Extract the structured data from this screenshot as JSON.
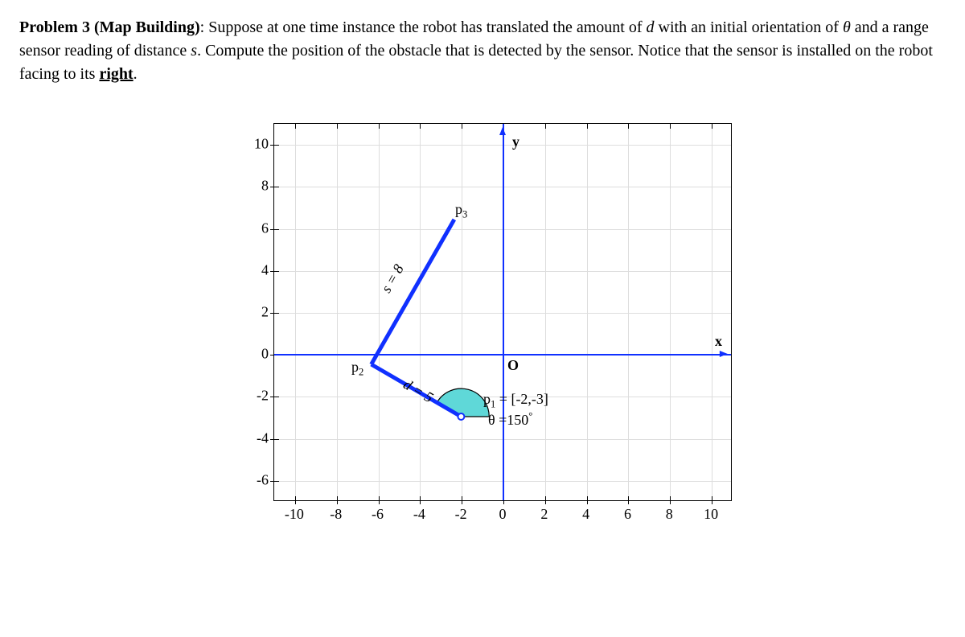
{
  "problem": {
    "label_bold": "Problem 3 (Map Building)",
    "sentence_part1": ": Suppose at one time instance the robot has translated the amount of ",
    "var_d": "d",
    "sentence_part2": " with an initial orientation of ",
    "var_theta": "θ",
    "sentence_part3": " and a range sensor reading of distance ",
    "var_s": "s",
    "sentence_part4": ". Compute the position of the obstacle that is detected by the sensor. Notice that the sensor is installed on the robot facing to its ",
    "right_word": "right",
    "period": "."
  },
  "chart_data": {
    "type": "line",
    "xlim": [
      -11,
      11
    ],
    "ylim": [
      -7,
      11
    ],
    "xticks": [
      -10,
      -8,
      -6,
      -4,
      -2,
      0,
      2,
      4,
      6,
      8,
      10
    ],
    "yticks": [
      -6,
      -4,
      -2,
      0,
      2,
      4,
      6,
      8,
      10
    ],
    "axes": {
      "x_label": "x",
      "y_label": "y",
      "origin_label": "O"
    },
    "points": {
      "p1": {
        "x": -2,
        "y": -3,
        "label": "p",
        "sub": "1",
        "value_text": " = [-2,-3]"
      },
      "p2": {
        "x": -6.33,
        "y": -0.5,
        "label": "p",
        "sub": "2"
      },
      "p3": {
        "x": -2.33,
        "y": 6.43,
        "label": "p",
        "sub": "3"
      }
    },
    "segments": [
      {
        "from": "p1",
        "to": "p2",
        "label": "d = 5"
      },
      {
        "from": "p2",
        "to": "p3",
        "label": "s = 8"
      }
    ],
    "angle": {
      "at": "p1",
      "value_deg": 150,
      "label_prefix": "θ =",
      "label_value": "150",
      "label_suffix": "°"
    }
  }
}
